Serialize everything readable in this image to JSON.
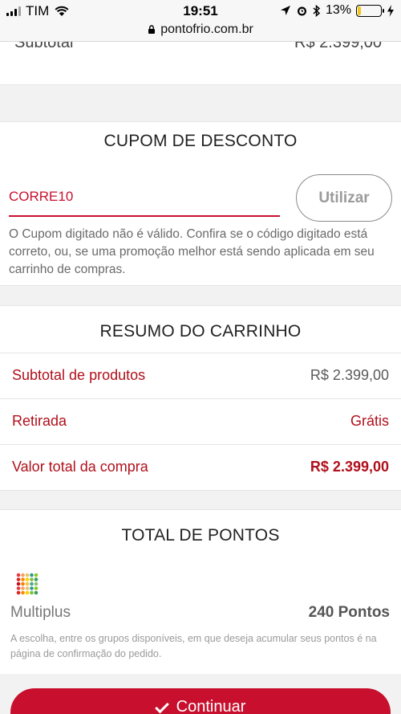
{
  "status_bar": {
    "carrier": "TIM",
    "time": "19:51",
    "battery_percent": "13%",
    "battery_level": 0.13,
    "url": "pontofrio.com.br"
  },
  "partial_row": {
    "label": "Subtotal",
    "value": "R$ 2.399,00"
  },
  "coupon": {
    "title": "CUPOM DE DESCONTO",
    "input_value": "CORRE10",
    "apply_label": "Utilizar",
    "error_message": "O Cupom digitado não é válido. Confira se o código digitado está correto, ou, se uma promoção melhor está sendo aplicada em seu carrinho de compras."
  },
  "summary": {
    "title": "RESUMO DO CARRINHO",
    "rows": [
      {
        "label": "Subtotal de produtos",
        "value": "R$ 2.399,00"
      },
      {
        "label": "Retirada",
        "value": "Grátis"
      },
      {
        "label": "Valor total da compra",
        "value": "R$ 2.399,00"
      }
    ]
  },
  "points": {
    "title": "TOTAL DE PONTOS",
    "program": "Multiplus",
    "amount": "240 Pontos",
    "note": "A escolha, entre os grupos disponíveis, em que deseja acumular seus pontos é na página de confirmação do pedido."
  },
  "actions": {
    "continue_label": "Continuar"
  },
  "colors": {
    "brand_red": "#c8102e",
    "battery_yellow": "#f3c516"
  },
  "icons": [
    "signal-icon",
    "wifi-icon",
    "location-arrow-icon",
    "alarm-icon",
    "bluetooth-icon",
    "battery-icon",
    "charging-icon",
    "lock-icon",
    "multiplus-logo-icon",
    "check-icon"
  ]
}
